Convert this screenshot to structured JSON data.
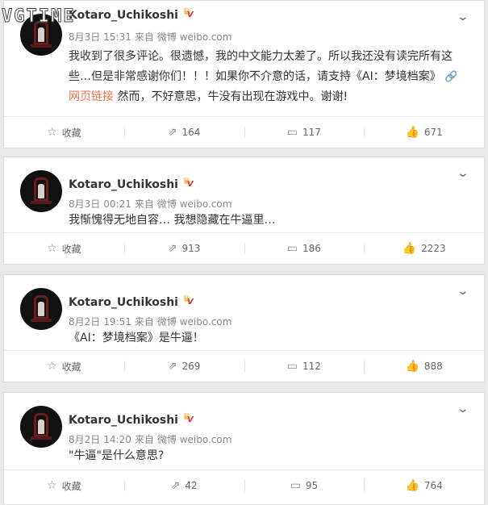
{
  "watermark": "VGTIME",
  "posts": [
    {
      "user": "Kotaro_Uchikoshi",
      "date": "8月3日",
      "time": "15:31",
      "source_prefix": "来自",
      "source": "微博 weibo.com",
      "text_line1": "我收到了很多评论。很遗憾，我的中文能力太差了。所以我还没有读完所有这",
      "text_line2": "些…但是非常感谢你们！！！如果你不介意的话，请支持《AI：梦境档案》",
      "link_text": "网页链接",
      "text_line3": " 然而，不好意思，牛没有出现在游戏中。谢谢!",
      "favorite_label": "收藏",
      "reposts": "164",
      "comments": "117",
      "likes": "671"
    },
    {
      "user": "Kotaro_Uchikoshi",
      "date": "8月3日",
      "time": "00:21",
      "source_prefix": "来自",
      "source": "微博 weibo.com",
      "text": "我惭愧得无地自容… 我想隐藏在牛逼里…",
      "favorite_label": "收藏",
      "reposts": "913",
      "comments": "186",
      "likes": "2223"
    },
    {
      "user": "Kotaro_Uchikoshi",
      "date": "8月2日",
      "time": "19:51",
      "source_prefix": "来自",
      "source": "微博 weibo.com",
      "text": "《AI：梦境档案》是牛逼！",
      "favorite_label": "收藏",
      "reposts": "269",
      "comments": "112",
      "likes": "888"
    },
    {
      "user": "Kotaro_Uchikoshi",
      "date": "8月2日",
      "time": "14:20",
      "source_prefix": "来自",
      "source": "微博 weibo.com",
      "text": "\"牛逼\"是什么意思?",
      "favorite_label": "收藏",
      "reposts": "42",
      "comments": "95",
      "likes": "764"
    }
  ],
  "icons": {
    "favorite": "star-outline-icon",
    "repost": "repost-icon",
    "comment": "comment-icon",
    "like": "thumbs-up-icon",
    "menu": "chevron-down-icon",
    "link": "link-icon"
  },
  "colors": {
    "link": "#eb7350",
    "vip": "#f5a623"
  }
}
